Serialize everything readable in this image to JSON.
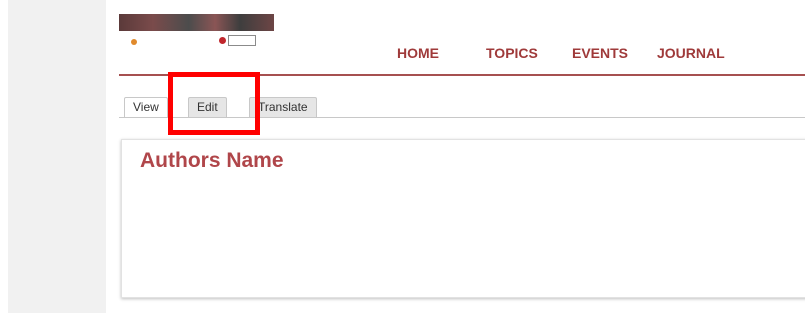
{
  "nav": {
    "items": [
      {
        "label": "HOME"
      },
      {
        "label": "TOPICS"
      },
      {
        "label": "EVENTS"
      },
      {
        "label": "JOURNAL"
      }
    ]
  },
  "tabs": [
    {
      "label": "View",
      "active": true
    },
    {
      "label": "Edit",
      "active": false
    },
    {
      "label": "Translate",
      "active": false
    }
  ],
  "content": {
    "title": "Authors Name"
  },
  "colors": {
    "brand": "#9f3a3a",
    "title": "#b0464a",
    "highlight": "#ff0000"
  }
}
